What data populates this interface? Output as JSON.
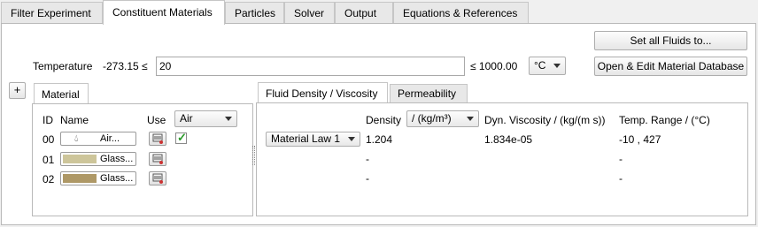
{
  "tabs": [
    "Filter Experiment",
    "Constituent Materials",
    "Particles",
    "Solver",
    "Output",
    "Equations & References"
  ],
  "buttons": {
    "set_all_fluids": "Set all Fluids to...",
    "open_edit_db": "Open & Edit Material Database",
    "add": "+"
  },
  "temperature": {
    "label": "Temperature",
    "min_text": "-273.15 ≤",
    "value": "20",
    "max_text": "≤ 1000.00",
    "unit": "°C"
  },
  "material_panel": {
    "tab": "Material",
    "headers": {
      "id": "ID",
      "name": "Name",
      "use": "Use"
    },
    "use_select": "Air",
    "rows": [
      {
        "id": "00",
        "name": "Air...",
        "color": "#ffffff",
        "checked": true
      },
      {
        "id": "01",
        "name": "Glass...",
        "color": "#cdc59a",
        "checked": false
      },
      {
        "id": "02",
        "name": "Glass...",
        "color": "#ae9866",
        "checked": false
      }
    ]
  },
  "right_panel": {
    "tabs": [
      "Fluid Density / Viscosity",
      "Permeability"
    ],
    "headers": {
      "density": "Density",
      "density_unit": "/ (kg/m³)",
      "viscosity": "Dyn. Viscosity / (kg/(m s))",
      "temp_range": "Temp. Range / (°C)"
    },
    "rows": [
      {
        "law": "Material Law 1",
        "density": "1.204",
        "viscosity": "1.834e-05",
        "temp_range": "-10 , 427"
      },
      {
        "law": "",
        "density": "-",
        "viscosity": "",
        "temp_range": "-"
      },
      {
        "law": "",
        "density": "-",
        "viscosity": "",
        "temp_range": "-"
      }
    ]
  },
  "colors": {
    "accent_check": "#2a9a2a",
    "air_drop": "#333333"
  }
}
